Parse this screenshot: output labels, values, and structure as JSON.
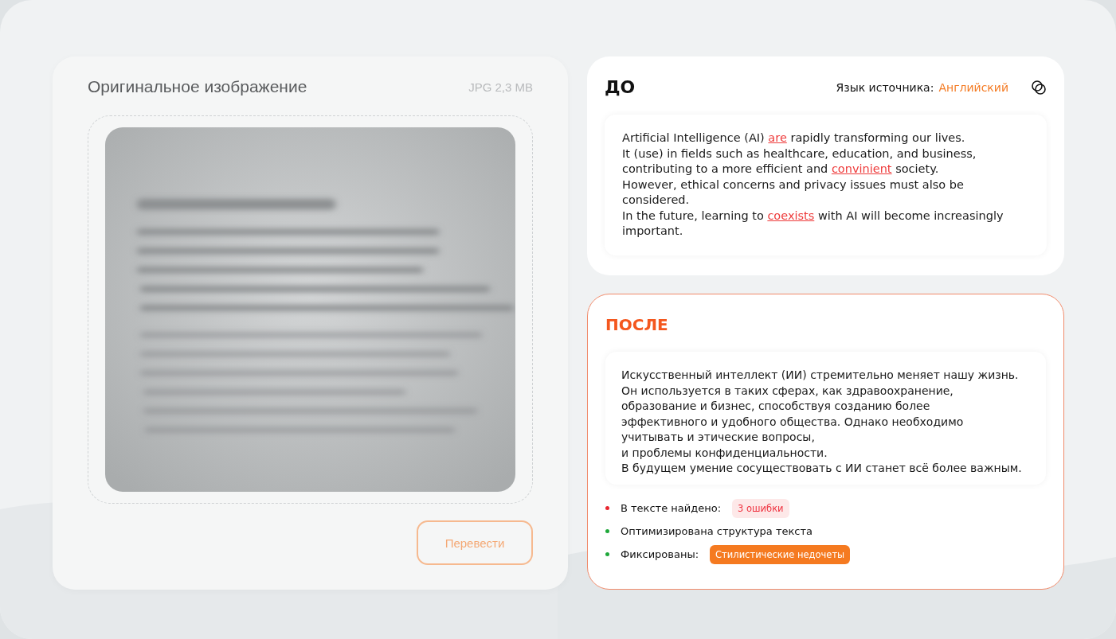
{
  "original": {
    "title": "Оригинальное изображение",
    "file_info": "JPG 2,3 MB",
    "button": "Перевести"
  },
  "before": {
    "title": "ДО",
    "language_label": "Язык источника:",
    "language": "Английский",
    "lines": [
      [
        {
          "text": "Artificial Intelligence (AI) ",
          "error": false
        },
        {
          "text": "are",
          "error": true
        },
        {
          "text": " rapidly transforming our lives.",
          "error": false
        }
      ],
      [
        {
          "text": "It (use) in fields such as healthcare, education, and business,",
          "error": false
        }
      ],
      [
        {
          "text": "contributing to a more efficient and ",
          "error": false
        },
        {
          "text": "convinient",
          "error": true
        },
        {
          "text": " society.",
          "error": false
        }
      ],
      [
        {
          "text": "However, ethical concerns and privacy issues must also be considered.",
          "error": false
        }
      ],
      [
        {
          "text": "In the future, learning to ",
          "error": false
        },
        {
          "text": "coexists",
          "error": true
        },
        {
          "text": " with AI will become increasingly important.",
          "error": false
        }
      ]
    ]
  },
  "after": {
    "title": "ПОСЛЕ",
    "lines": [
      "Искусственный интеллект (ИИ) стремительно меняет нашу жизнь.",
      "Он используется в таких сферах, как здравоохранение,",
      "образование и бизнес, способствуя созданию более",
      "эффективного и удобного общества. Однако необходимо",
      "учитывать и этические вопросы,",
      "и проблемы конфиденциальности.",
      "В будущем умение сосуществовать с ИИ станет всё более важным."
    ],
    "results": [
      {
        "label": "В тексте найдено:",
        "color": "#e8262f",
        "badge": {
          "kind": "soft",
          "text": "3 ошибки"
        }
      },
      {
        "label": "Оптимизирована структура текста",
        "color": "#1fa83a"
      },
      {
        "label": "Фиксированы:",
        "color": "#1fa83a",
        "badge": {
          "kind": "solid",
          "text": "Стилистические недочеты"
        }
      }
    ]
  }
}
